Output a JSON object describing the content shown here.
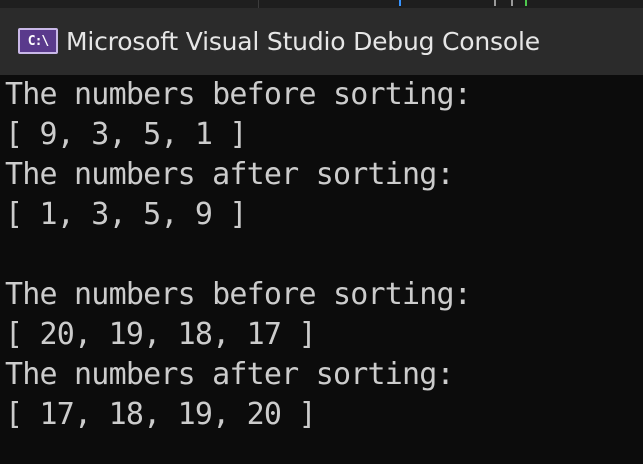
{
  "window": {
    "title": "Microsoft Visual Studio Debug Console",
    "icon": "console-app-icon",
    "icon_text": "C:\\"
  },
  "colors": {
    "background": "#0c0c0c",
    "titlebar": "#2b2b2b",
    "text": "#cccccc",
    "icon_accent": "#5a3a8c"
  },
  "console": {
    "lines": [
      "The numbers before sorting:",
      "[ 9, 3, 5, 1 ]",
      "The numbers after sorting:",
      "[ 1, 3, 5, 9 ]",
      "",
      "The numbers before sorting:",
      "[ 20, 19, 18, 17 ]",
      "The numbers after sorting:",
      "[ 17, 18, 19, 20 ]"
    ]
  }
}
